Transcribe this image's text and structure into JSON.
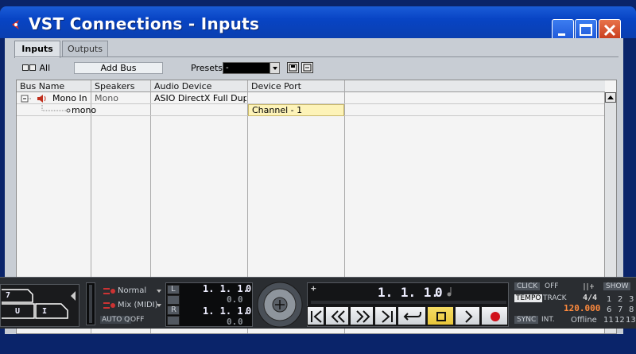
{
  "window": {
    "title": "VST Connections - Inputs"
  },
  "tabs": [
    {
      "label": "Inputs",
      "active": true
    },
    {
      "label": "Outputs",
      "active": false
    }
  ],
  "toolbar": {
    "all_label": "All",
    "add_bus_label": "Add Bus",
    "presets_label": "Presets",
    "presets_value": "-"
  },
  "table": {
    "headers": [
      "Bus Name",
      "Speakers",
      "Audio Device",
      "Device Port"
    ],
    "rows": [
      {
        "bus_name": "Mono In",
        "speakers": "Mono",
        "audio_device": "ASIO DirectX Full Duplex D",
        "device_port": ""
      },
      {
        "bus_name": "mono",
        "speakers": "",
        "audio_device": "",
        "device_port": "Channel - 1"
      }
    ]
  },
  "transport": {
    "pad_keys": [
      "7",
      "U",
      "I"
    ],
    "mode_normal": "Normal",
    "mode_mix": "Mix (MIDI)",
    "autoq_label": "AUTO Q",
    "autoq_value": "OFF",
    "left_locator": "1. 1. 1.",
    "left_locator_ticks": "0",
    "left_offset": "0.",
    "left_offset_ticks": "0",
    "right_locator": "1. 1. 1.",
    "right_locator_ticks": "0",
    "right_offset": "0.",
    "right_offset_ticks": "0",
    "primary_position": "1. 1. 1.",
    "primary_position_ticks": "0",
    "click_label": "CLICK",
    "click_value": "OFF",
    "tempo_label": "TEMPO",
    "track_label": "TRACK",
    "signature": "4/4",
    "tempo_value": "120.000",
    "sync_label": "SYNC",
    "sync_source": "INT.",
    "sync_status": "Offline",
    "show_label": "SHOW",
    "marker_numbers": [
      "1",
      "2",
      "3",
      "6",
      "7",
      "8",
      "11",
      "12",
      "13"
    ],
    "colors": {
      "record": "#d0111a",
      "stop_active": "#f2d44a",
      "tempo_value": "#ff8a3d"
    }
  }
}
